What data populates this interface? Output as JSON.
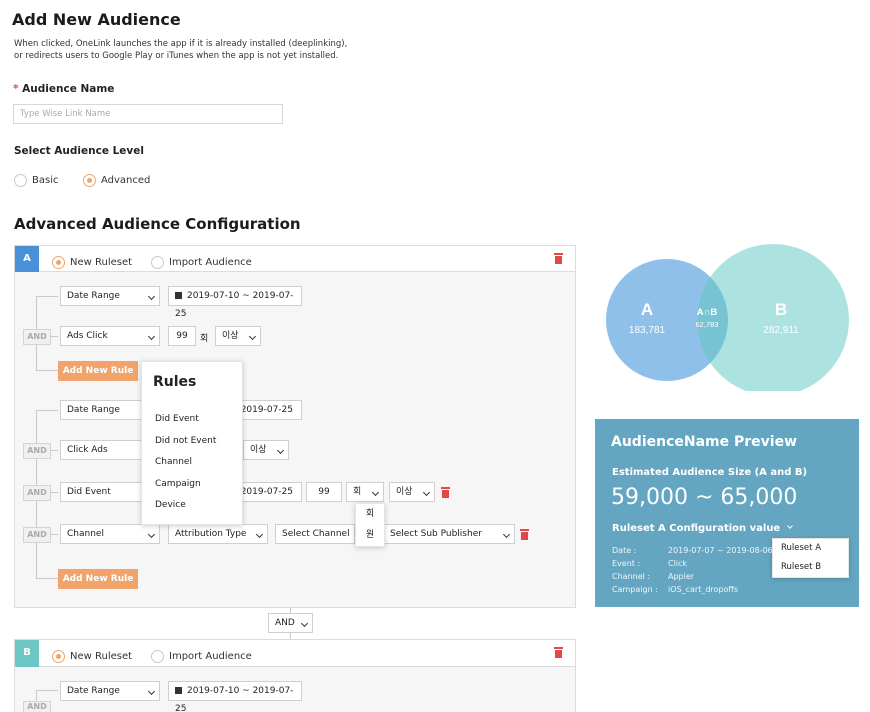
{
  "header": {
    "title": "Add New Audience",
    "description_line1": "When clicked, OneLink launches the app if it is already installed (deeplinking),",
    "description_line2": "or redirects users to Google Play or iTunes when the app is not yet installed."
  },
  "audience_name": {
    "required_mark": "*",
    "label": "Audience Name",
    "placeholder": "Type Wise Link Name",
    "value": ""
  },
  "audience_level": {
    "label": "Select Audience Level",
    "options": [
      "Basic",
      "Advanced"
    ],
    "selected": "Advanced"
  },
  "config": {
    "title": "Advanced Audience Configuration",
    "and_connector": "AND"
  },
  "ruleset_a": {
    "letter": "A",
    "color": "#4a90d9",
    "options": [
      "New Ruleset",
      "Import Audience"
    ],
    "selected": "New Ruleset",
    "group1": {
      "rule1": {
        "type": "Date Range",
        "date": "2019-07-10 ~ 2019-07-25"
      },
      "rule2": {
        "type": "Ads Click",
        "count": "99",
        "unit": "회",
        "cond": "이상"
      },
      "and": "AND",
      "add_button": "Add New Rule"
    },
    "group2": {
      "rule1": {
        "type": "Date Range",
        "date_tail": "2019-07-25"
      },
      "rule2": {
        "type": "Click Ads",
        "cond": "이상"
      },
      "rule3": {
        "type": "Did Event",
        "date_tail": "2019-07-25",
        "count": "99",
        "unit": "회",
        "cond": "이상"
      },
      "rule4": {
        "type": "Channel",
        "attribution": "Attribution Type",
        "channel": "Select Channel",
        "sub_publisher": "Select Sub Publisher"
      },
      "and": "AND",
      "add_button": "Add New Rule"
    }
  },
  "rules_popup": {
    "title": "Rules",
    "items": [
      "Did Event",
      "Did not Event",
      "Channel",
      "Campaign",
      "Device"
    ]
  },
  "unit_popup": {
    "items": [
      "회",
      "원"
    ]
  },
  "ruleset_b": {
    "letter": "B",
    "color": "#6cc7c4",
    "options": [
      "New Ruleset",
      "Import Audience"
    ],
    "selected": "New Ruleset",
    "rule1": {
      "type": "Date Range",
      "date": "2019-07-10 ~ 2019-07-25"
    },
    "and": "AND"
  },
  "venn": {
    "a_label": "A",
    "a_value": "183,781",
    "b_label": "B",
    "b_value": "282,911",
    "ab_label": "A∩B",
    "ab_value": "62,783",
    "a_color": "#8fc0ea",
    "b_color": "#a8e2df"
  },
  "preview": {
    "title": "AudienceName Preview",
    "estimated_label": "Estimated Audience Size (A and B)",
    "estimated_value": "59,000 ~ 65,000",
    "ruleset_label": "Ruleset A Configuration value",
    "rows": [
      {
        "key": "Date :",
        "value": "2019-07-07 ~ 2019-08-06"
      },
      {
        "key": "Event :",
        "value": "Click"
      },
      {
        "key": "Channel :",
        "value": "Appier"
      },
      {
        "key": "Campaign :",
        "value": "iOS_cart_dropoffs"
      }
    ],
    "dropdown_items": [
      "Ruleset A",
      "Ruleset B"
    ],
    "background": "#64a6c1"
  }
}
